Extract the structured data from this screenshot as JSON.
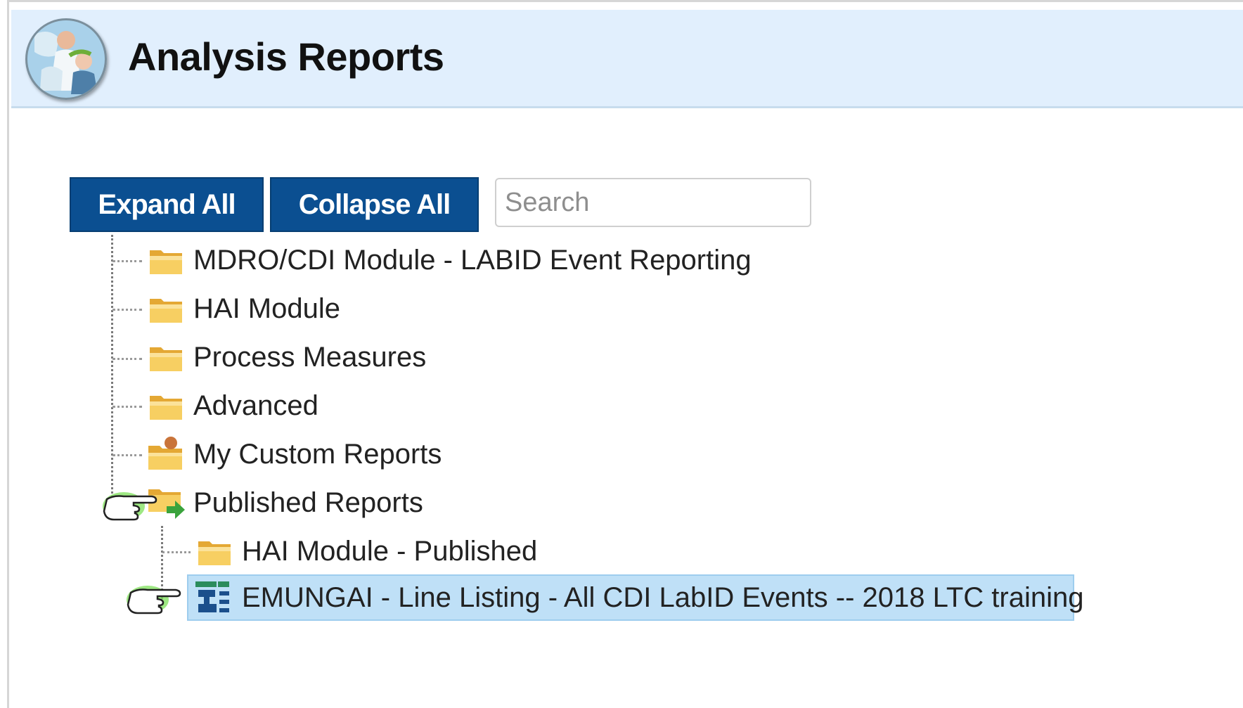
{
  "header": {
    "title": "Analysis Reports"
  },
  "toolbar": {
    "expand_label": "Expand All",
    "collapse_label": "Collapse All",
    "search_placeholder": "Search"
  },
  "tree": {
    "items": [
      {
        "label": "MDRO/CDI Module - LABID Event Reporting",
        "icon": "folder-icon"
      },
      {
        "label": "HAI Module",
        "icon": "folder-icon"
      },
      {
        "label": "Process Measures",
        "icon": "folder-icon"
      },
      {
        "label": "Advanced",
        "icon": "folder-icon"
      },
      {
        "label": "My Custom Reports",
        "icon": "custom-reports-folder-icon"
      },
      {
        "label": "Published Reports",
        "icon": "published-folder-icon",
        "expanded": true
      },
      {
        "label": "HAI Module - Published",
        "icon": "folder-icon",
        "level": 2
      },
      {
        "label": "EMUNGAI - Line Listing - All CDI LabID Events -- 2018 LTC training",
        "icon": "report-icon",
        "level": 2,
        "selected": true
      }
    ]
  },
  "colors": {
    "header_bg": "#e1effd",
    "button_bg": "#0b4f91",
    "selected_bg": "#bfe0f7",
    "folder": "#f3c24f"
  }
}
